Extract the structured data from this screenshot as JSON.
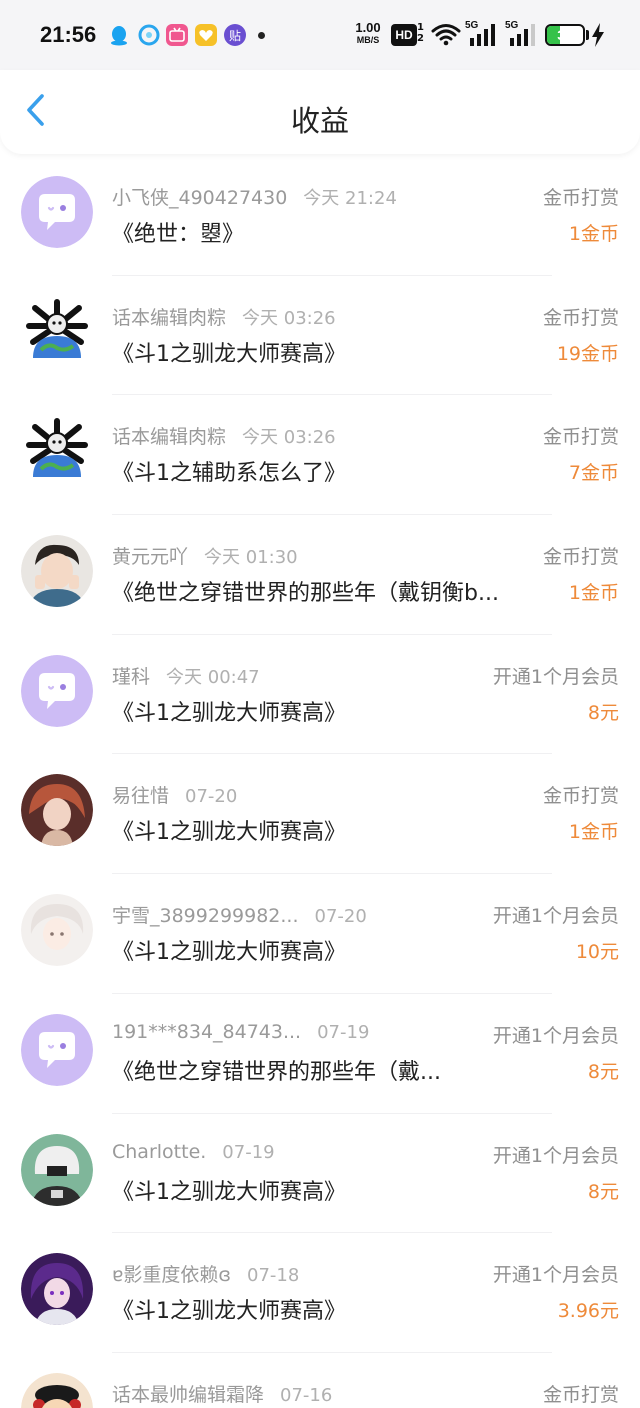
{
  "status_bar": {
    "time": "21:56",
    "speed_value": "1.00",
    "speed_unit": "MB/S",
    "hd_label": "HD",
    "hd_sub": "1\n2",
    "net1": "5G",
    "net2": "5G",
    "battery": "37",
    "battery_level_percent": 37,
    "colors": {
      "battery_fill": "#35c24a"
    }
  },
  "header": {
    "title": "收益",
    "back_icon": "chevron-left-icon"
  },
  "colors": {
    "accent": "#3aa0ec",
    "amount": "#ee8a3a",
    "default_avatar": "#cdbcf5"
  },
  "items": [
    {
      "user": "小飞侠_490427430",
      "time": "今天 21:24",
      "type": "金币打赏",
      "work": "《绝世：曌》",
      "amount": "1金币",
      "avatar": "default-chat-avatar"
    },
    {
      "user": "话本编辑肉粽",
      "time": "今天 03:26",
      "type": "金币打赏",
      "work": "《斗1之驯龙大师赛高》",
      "amount": "19金币",
      "avatar": "earth-bones-avatar"
    },
    {
      "user": "话本编辑肉粽",
      "time": "今天 03:26",
      "type": "金币打赏",
      "work": "《斗1之辅助系怎么了》",
      "amount": "7金币",
      "avatar": "earth-bones-avatar"
    },
    {
      "user": "黄元元吖",
      "time": "今天 01:30",
      "type": "金币打赏",
      "work": "《绝世之穿错世界的那些年（戴钥衡b...",
      "amount": "1金币",
      "avatar": "photo-avatar"
    },
    {
      "user": "瑾科",
      "time": "今天 00:47",
      "type": "开通1个月会员",
      "work": "《斗1之驯龙大师赛高》",
      "amount": "8元",
      "avatar": "default-chat-avatar"
    },
    {
      "user": "易往惜",
      "time": "07-20",
      "type": "金币打赏",
      "work": "《斗1之驯龙大师赛高》",
      "amount": "1金币",
      "avatar": "anime-avatar-red"
    },
    {
      "user": "宇雪_3899299982...",
      "time": "07-20",
      "type": "开通1个月会员",
      "work": "《斗1之驯龙大师赛高》",
      "amount": "10元",
      "avatar": "anime-avatar-white"
    },
    {
      "user": "191***834_84743...",
      "time": "07-19",
      "type": "开通1个月会员",
      "work": "《绝世之穿错世界的那些年（戴...",
      "amount": "8元",
      "avatar": "default-chat-avatar"
    },
    {
      "user": "Charlotte.",
      "time": "07-19",
      "type": "开通1个月会员",
      "work": "《斗1之驯龙大师赛高》",
      "amount": "8元",
      "avatar": "anime-avatar-gray"
    },
    {
      "user": "ɐ影重度依赖ɞ",
      "time": "07-18",
      "type": "开通1个月会员",
      "work": "《斗1之驯龙大师赛高》",
      "amount": "3.96元",
      "avatar": "anime-avatar-purple"
    },
    {
      "user": "话本最帅编辑霜降",
      "time": "07-16",
      "type": "金币打赏",
      "work": "",
      "amount": "",
      "avatar": "cartoon-avatar"
    }
  ]
}
